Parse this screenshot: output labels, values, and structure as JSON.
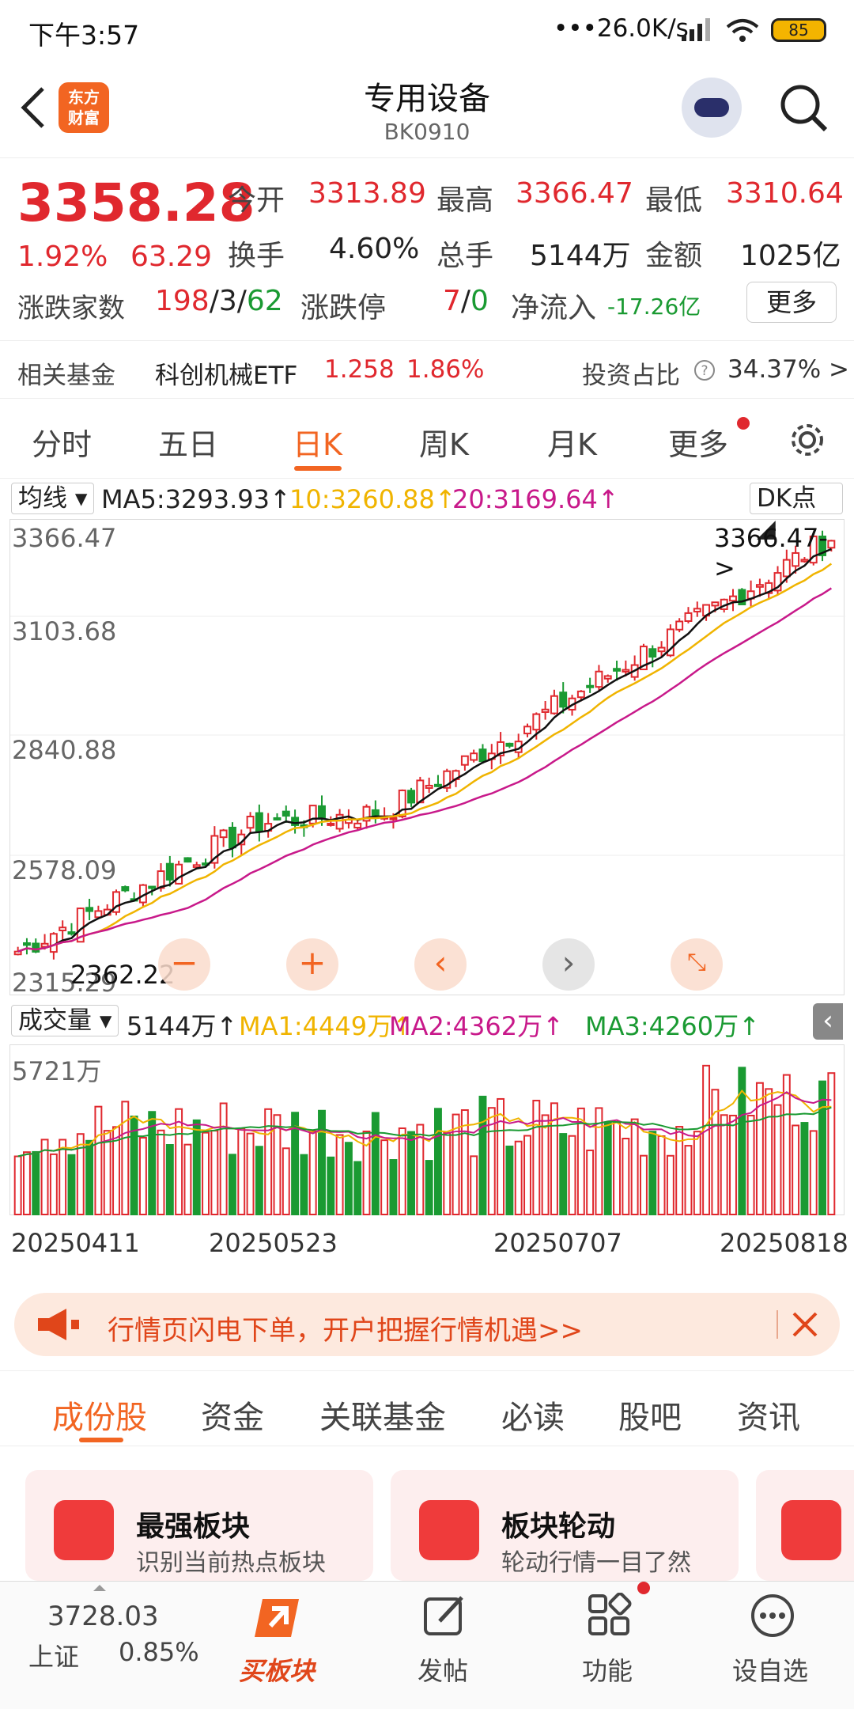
{
  "status": {
    "time": "下午3:57",
    "network": "•••26.0K/s",
    "battery": "85"
  },
  "header": {
    "title": "专用设备",
    "code": "BK0910",
    "logo_line1": "东方",
    "logo_line2": "财富"
  },
  "quote": {
    "price": "3358.28",
    "pct": "1.92%",
    "chg": "63.29",
    "open_label": "今开",
    "open": "3313.89",
    "high_label": "最高",
    "high": "3366.47",
    "low_label": "最低",
    "low": "3310.64",
    "turnover_label": "换手",
    "turnover": "4.60%",
    "volume_label": "总手",
    "volume": "5144万",
    "amount_label": "金额",
    "amount": "1025亿",
    "adv_label": "涨跌家数",
    "adv_up": "198",
    "adv_flat": "3",
    "adv_down": "62",
    "limit_label": "涨跌停",
    "limit_up": "7",
    "limit_down": "0",
    "flow_label": "净流入",
    "flow": "-17.26亿",
    "more": "更多"
  },
  "fund": {
    "label": "相关基金",
    "name": "科创机械ETF",
    "price": "1.258",
    "pct": "1.86%",
    "ratio_label": "投资占比",
    "ratio": "34.37% >"
  },
  "tabs": [
    "分时",
    "五日",
    "日K",
    "周K",
    "月K",
    "更多"
  ],
  "ma": {
    "dropdown": "均线",
    "ma5": "MA5:3293.93",
    "ma10": "10:3260.88",
    "ma20": "20:3169.64",
    "dk": "DK点"
  },
  "vol_header": {
    "dropdown": "成交量",
    "vol": "5144万",
    "ma1": "MA1:4449万",
    "ma2": "MA2:4362万",
    "ma3": "MA3:4260万"
  },
  "chart_data": {
    "type": "candlestick",
    "y_ticks": [
      "3366.47",
      "3103.68",
      "2840.88",
      "2578.09",
      "2315.29"
    ],
    "max_label": "3366.47->",
    "min_label": "2362.22",
    "vol_max_label": "5721万",
    "x_ticks": [
      "20250411",
      "20250523",
      "20250707",
      "20250818"
    ],
    "colors": {
      "up": "#e0282e",
      "down": "#1a9a32",
      "ma5": "#111111",
      "ma10": "#f0b400",
      "ma20": "#c8198a"
    }
  },
  "banner": {
    "text": "行情页闪电下单，开户把握行情机遇>>"
  },
  "subtabs": [
    "成份股",
    "资金",
    "关联基金",
    "必读",
    "股吧",
    "资讯"
  ],
  "cards": [
    {
      "title": "最强板块",
      "sub": "识别当前热点板块"
    },
    {
      "title": "板块轮动",
      "sub": "轮动行情一目了然"
    }
  ],
  "bottom": {
    "index_value": "3728.03",
    "index_name": "上证",
    "index_pct": "0.85%",
    "buy": "买板块",
    "post": "发帖",
    "func": "功能",
    "fav": "设自选"
  }
}
